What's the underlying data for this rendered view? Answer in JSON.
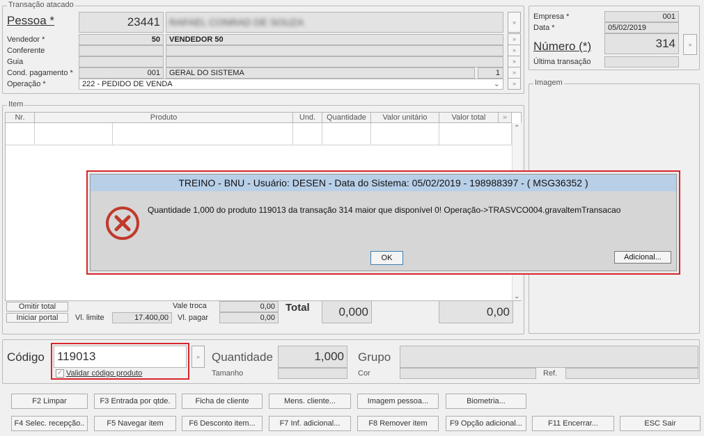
{
  "transacao": {
    "title": "Transação atacado",
    "pessoa_label": "Pessoa *",
    "pessoa_code": "23441",
    "pessoa_name": "RAFAEL CONRAD DE SOUZA",
    "vendedor_label": "Vendedor *",
    "vendedor_code": "50",
    "vendedor_name": "VENDEDOR 50",
    "conferente_label": "Conferente",
    "guia_label": "Guia",
    "cond_label": "Cond. pagamento *",
    "cond_code": "001",
    "cond_name": "GERAL DO SISTEMA",
    "cond_num": "1",
    "operacao_label": "Operação *",
    "operacao_value": "222 - PEDIDO DE VENDA"
  },
  "empresa": {
    "empresa_label": "Empresa *",
    "empresa_value": "001",
    "data_label": "Data *",
    "data_value": "05/02/2019",
    "numero_label": "Número (*)",
    "numero_value": "314",
    "ultima_label": "Última transação"
  },
  "imagem": {
    "title": "Imagem"
  },
  "item": {
    "title": "Item",
    "columns": [
      "Nr.",
      "Produto",
      "Und.",
      "Quantidade",
      "Valor unitário",
      "Valor total"
    ]
  },
  "totals": {
    "omitir_label": "Omitir total",
    "iniciar_label": "Iniciar portal",
    "vl_limite_label": "Vl. limite",
    "vl_limite_value": "17.400,00",
    "vale_troca_label": "Vale troca",
    "vale_troca_value": "0,00",
    "vl_pagar_label": "Vl. pagar",
    "vl_pagar_value": "0,00",
    "total_label": "Total",
    "total_qty": "0,000",
    "total_value": "0,00"
  },
  "codigo": {
    "codigo_label": "Código",
    "codigo_value": "119013",
    "validar_label": "Validar código produto",
    "quantidade_label": "Quantidade",
    "quantidade_value": "1,000",
    "tamanho_label": "Tamanho",
    "grupo_label": "Grupo",
    "cor_label": "Cor",
    "ref_label": "Ref."
  },
  "dialog": {
    "title": "TREINO - BNU - Usuário: DESEN - Data do Sistema: 05/02/2019 - 198988397 - ( MSG36352 )",
    "message": "Quantidade 1,000 do produto 119013 da transação 314 maior que disponível 0! Operação->TRASVCO004.gravaltemTransacao",
    "ok_label": "OK",
    "adicional_label": "Adicional..."
  },
  "fkeys_row1": [
    "F2 Limpar",
    "F3 Entrada por qtde.",
    "Ficha de cliente",
    "Mens. cliente...",
    "Imagem pessoa...",
    "Biometria..."
  ],
  "fkeys_row2": [
    "F4 Selec. recepção..",
    "F5 Navegar item",
    "F6 Desconto item...",
    "F7 Inf. adicional...",
    "F8 Remover item",
    "F9 Opção adicional...",
    "F11 Encerrar...",
    "ESC Sair"
  ],
  "colors": {
    "accent_red": "#d9252b",
    "dialog_title_bg": "#b8cfe8",
    "error_icon": "#c0392b"
  }
}
